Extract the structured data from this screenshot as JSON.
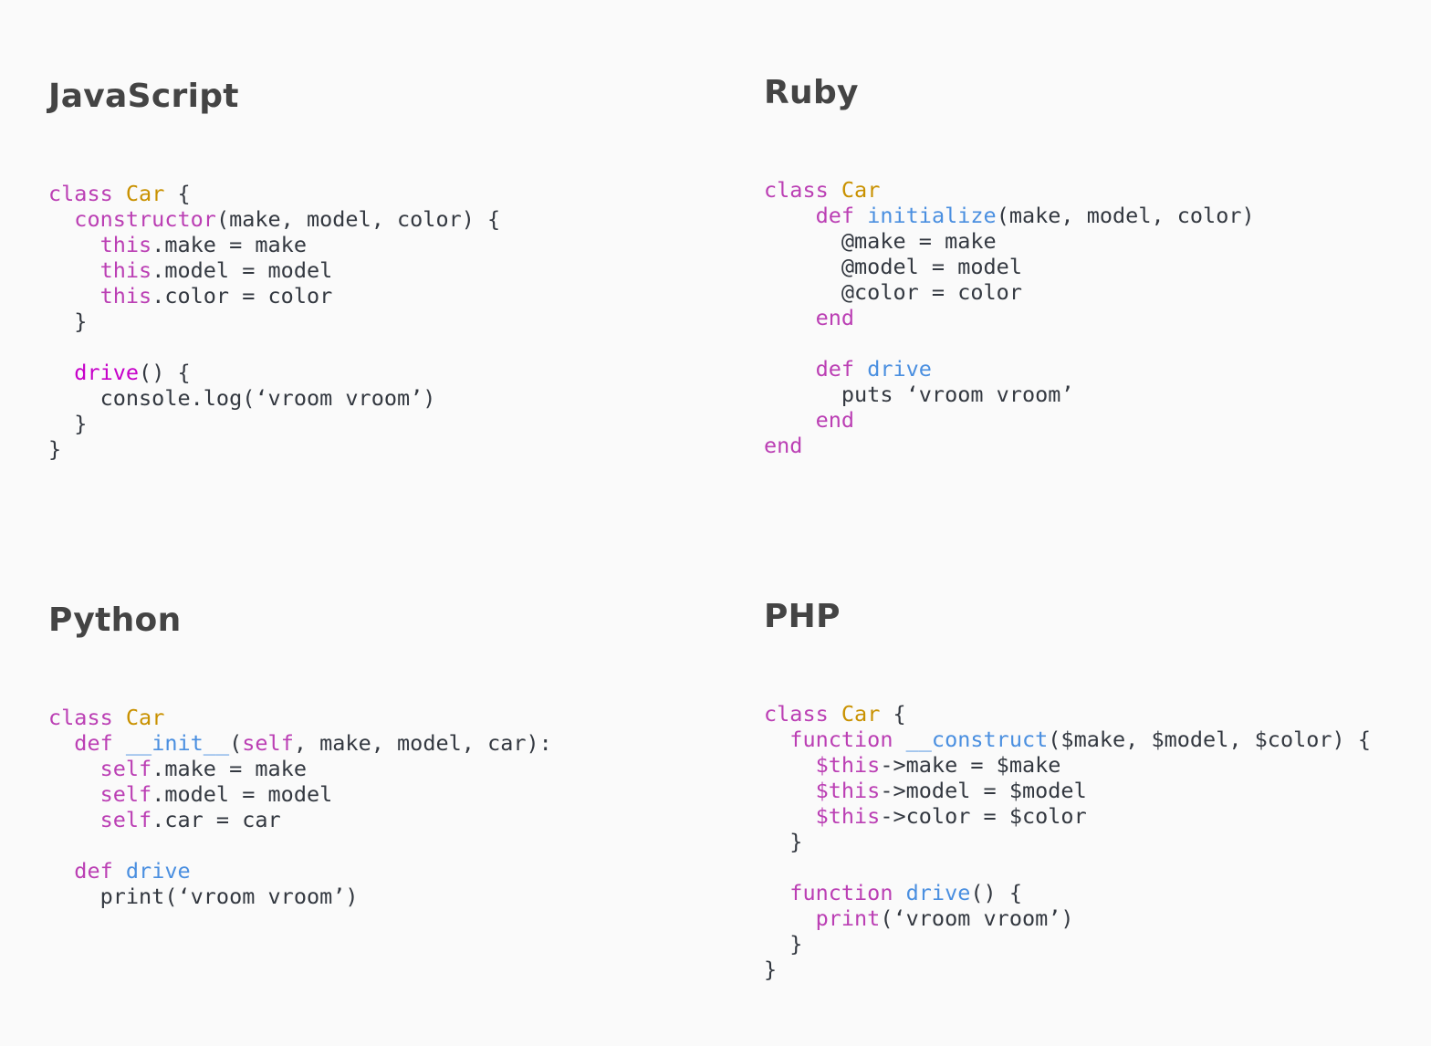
{
  "colors": {
    "background": "#fafafa",
    "title": "#444444",
    "plain": "#333840",
    "keyword": "#bb3fb4",
    "keyword_alt": "#c600c9",
    "class_name": "#c99100",
    "function_name": "#4a8fe0"
  },
  "panels": [
    {
      "id": "js",
      "title": "JavaScript",
      "lines": [
        [
          {
            "t": "class",
            "k": "kw"
          },
          {
            "t": " ",
            "k": "plain"
          },
          {
            "t": "Car",
            "k": "cls"
          },
          {
            "t": " {",
            "k": "plain"
          }
        ],
        [
          {
            "t": "  ",
            "k": "plain"
          },
          {
            "t": "constructor",
            "k": "kw"
          },
          {
            "t": "(make, model, color) {",
            "k": "plain"
          }
        ],
        [
          {
            "t": "    ",
            "k": "plain"
          },
          {
            "t": "this",
            "k": "kw"
          },
          {
            "t": ".make = make",
            "k": "plain"
          }
        ],
        [
          {
            "t": "    ",
            "k": "plain"
          },
          {
            "t": "this",
            "k": "kw"
          },
          {
            "t": ".model = model",
            "k": "plain"
          }
        ],
        [
          {
            "t": "    ",
            "k": "plain"
          },
          {
            "t": "this",
            "k": "kw"
          },
          {
            "t": ".color = color",
            "k": "plain"
          }
        ],
        [
          {
            "t": "  }",
            "k": "plain"
          }
        ],
        [
          {
            "t": "",
            "k": "plain"
          }
        ],
        [
          {
            "t": "  ",
            "k": "plain"
          },
          {
            "t": "drive",
            "k": "kw2"
          },
          {
            "t": "() {",
            "k": "plain"
          }
        ],
        [
          {
            "t": "    console.log(‘vroom vroom’)",
            "k": "plain"
          }
        ],
        [
          {
            "t": "  }",
            "k": "plain"
          }
        ],
        [
          {
            "t": "}",
            "k": "plain"
          }
        ]
      ]
    },
    {
      "id": "ruby",
      "title": "Ruby",
      "lines": [
        [
          {
            "t": "class",
            "k": "kw"
          },
          {
            "t": " ",
            "k": "plain"
          },
          {
            "t": "Car",
            "k": "cls"
          }
        ],
        [
          {
            "t": "    ",
            "k": "plain"
          },
          {
            "t": "def",
            "k": "kw"
          },
          {
            "t": " ",
            "k": "plain"
          },
          {
            "t": "initialize",
            "k": "fn"
          },
          {
            "t": "(make, model, color)",
            "k": "plain"
          }
        ],
        [
          {
            "t": "      @make = make",
            "k": "plain"
          }
        ],
        [
          {
            "t": "      @model = model",
            "k": "plain"
          }
        ],
        [
          {
            "t": "      @color = color",
            "k": "plain"
          }
        ],
        [
          {
            "t": "    ",
            "k": "plain"
          },
          {
            "t": "end",
            "k": "kw"
          }
        ],
        [
          {
            "t": "",
            "k": "plain"
          }
        ],
        [
          {
            "t": "    ",
            "k": "plain"
          },
          {
            "t": "def",
            "k": "kw"
          },
          {
            "t": " ",
            "k": "plain"
          },
          {
            "t": "drive",
            "k": "fn"
          }
        ],
        [
          {
            "t": "      puts ‘vroom vroom’",
            "k": "plain"
          }
        ],
        [
          {
            "t": "    ",
            "k": "plain"
          },
          {
            "t": "end",
            "k": "kw"
          }
        ],
        [
          {
            "t": "end",
            "k": "kw"
          }
        ]
      ]
    },
    {
      "id": "python",
      "title": "Python",
      "lines": [
        [
          {
            "t": "class",
            "k": "kw"
          },
          {
            "t": " ",
            "k": "plain"
          },
          {
            "t": "Car",
            "k": "cls"
          }
        ],
        [
          {
            "t": "  ",
            "k": "plain"
          },
          {
            "t": "def",
            "k": "kw"
          },
          {
            "t": " ",
            "k": "plain"
          },
          {
            "t": "__init__",
            "k": "fn"
          },
          {
            "t": "(",
            "k": "plain"
          },
          {
            "t": "self",
            "k": "kw"
          },
          {
            "t": ", make, model, car):",
            "k": "plain"
          }
        ],
        [
          {
            "t": "    ",
            "k": "plain"
          },
          {
            "t": "self",
            "k": "kw"
          },
          {
            "t": ".make = make",
            "k": "plain"
          }
        ],
        [
          {
            "t": "    ",
            "k": "plain"
          },
          {
            "t": "self",
            "k": "kw"
          },
          {
            "t": ".model = model",
            "k": "plain"
          }
        ],
        [
          {
            "t": "    ",
            "k": "plain"
          },
          {
            "t": "self",
            "k": "kw"
          },
          {
            "t": ".car = car",
            "k": "plain"
          }
        ],
        [
          {
            "t": "",
            "k": "plain"
          }
        ],
        [
          {
            "t": "  ",
            "k": "plain"
          },
          {
            "t": "def",
            "k": "kw"
          },
          {
            "t": " ",
            "k": "plain"
          },
          {
            "t": "drive",
            "k": "fn"
          }
        ],
        [
          {
            "t": "    print(‘vroom vroom’)",
            "k": "plain"
          }
        ]
      ]
    },
    {
      "id": "php",
      "title": "PHP",
      "lines": [
        [
          {
            "t": "class",
            "k": "kw"
          },
          {
            "t": " ",
            "k": "plain"
          },
          {
            "t": "Car",
            "k": "cls"
          },
          {
            "t": " {",
            "k": "plain"
          }
        ],
        [
          {
            "t": "  ",
            "k": "plain"
          },
          {
            "t": "function",
            "k": "kw"
          },
          {
            "t": " ",
            "k": "plain"
          },
          {
            "t": "__construct",
            "k": "fn"
          },
          {
            "t": "($make, $model, $color) {",
            "k": "plain"
          }
        ],
        [
          {
            "t": "    ",
            "k": "plain"
          },
          {
            "t": "$this",
            "k": "kw"
          },
          {
            "t": "->make = $make",
            "k": "plain"
          }
        ],
        [
          {
            "t": "    ",
            "k": "plain"
          },
          {
            "t": "$this",
            "k": "kw"
          },
          {
            "t": "->model = $model",
            "k": "plain"
          }
        ],
        [
          {
            "t": "    ",
            "k": "plain"
          },
          {
            "t": "$this",
            "k": "kw"
          },
          {
            "t": "->color = $color",
            "k": "plain"
          }
        ],
        [
          {
            "t": "  }",
            "k": "plain"
          }
        ],
        [
          {
            "t": "",
            "k": "plain"
          }
        ],
        [
          {
            "t": "  ",
            "k": "plain"
          },
          {
            "t": "function",
            "k": "kw"
          },
          {
            "t": " ",
            "k": "plain"
          },
          {
            "t": "drive",
            "k": "fn"
          },
          {
            "t": "() {",
            "k": "plain"
          }
        ],
        [
          {
            "t": "    ",
            "k": "plain"
          },
          {
            "t": "print",
            "k": "kw"
          },
          {
            "t": "(‘vroom vroom’)",
            "k": "plain"
          }
        ],
        [
          {
            "t": "  }",
            "k": "plain"
          }
        ],
        [
          {
            "t": "}",
            "k": "plain"
          }
        ]
      ]
    }
  ]
}
